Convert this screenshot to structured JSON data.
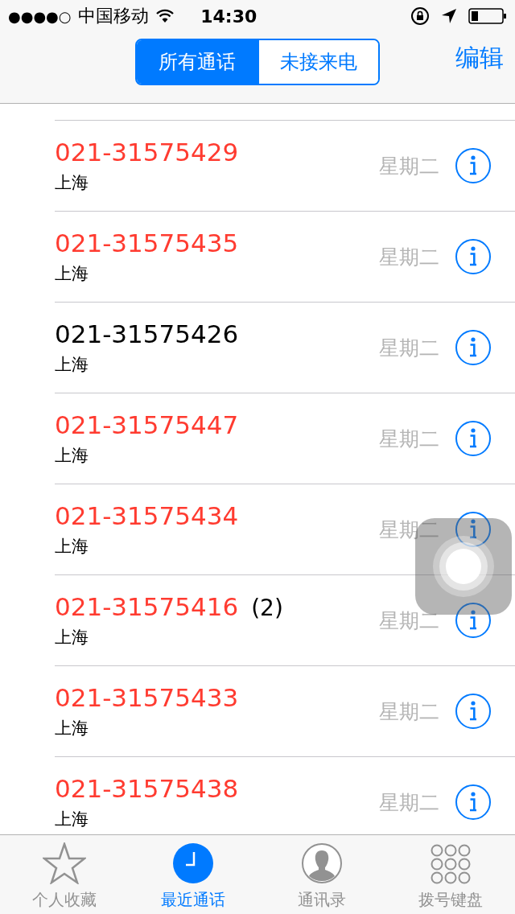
{
  "status_bar": {
    "signal_dots": "●●●●○",
    "carrier": "中国移动",
    "time": "14:30"
  },
  "nav": {
    "segments": [
      {
        "label": "所有通话",
        "selected": true
      },
      {
        "label": "未接来电",
        "selected": false
      }
    ],
    "edit": "编辑"
  },
  "calls": [
    {
      "number": "021-31575429",
      "location": "上海",
      "day": "星期二",
      "missed": true
    },
    {
      "number": "021-31575435",
      "location": "上海",
      "day": "星期二",
      "missed": true
    },
    {
      "number": "021-31575426",
      "location": "上海",
      "day": "星期二",
      "missed": false
    },
    {
      "number": "021-31575447",
      "location": "上海",
      "day": "星期二",
      "missed": true
    },
    {
      "number": "021-31575434",
      "location": "上海",
      "day": "星期二",
      "missed": true
    },
    {
      "number": "021-31575416",
      "count": "(2)",
      "location": "上海",
      "day": "星期二",
      "missed": true
    },
    {
      "number": "021-31575433",
      "location": "上海",
      "day": "星期二",
      "missed": true
    },
    {
      "number": "021-31575438",
      "location": "上海",
      "day": "星期二",
      "missed": true
    }
  ],
  "tab_bar": [
    {
      "kind": "star",
      "label": "个人收藏",
      "selected": false
    },
    {
      "kind": "clock",
      "label": "最近通话",
      "selected": true
    },
    {
      "kind": "contact",
      "label": "通讯录",
      "selected": false
    },
    {
      "kind": "keypad",
      "label": "拨号键盘",
      "selected": false
    }
  ]
}
